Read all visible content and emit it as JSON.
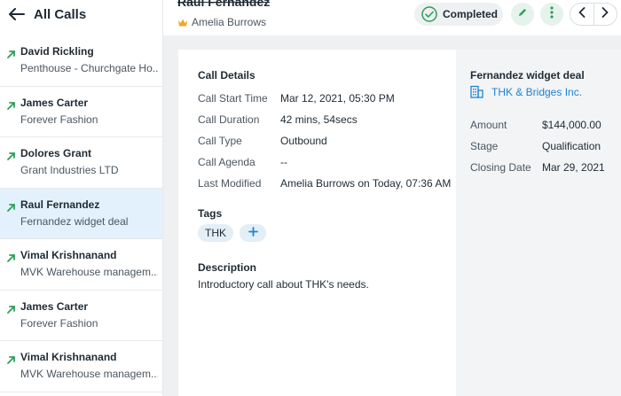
{
  "sidebar": {
    "title": "All Calls",
    "calls": [
      {
        "name": "David Rickling",
        "sub": "Penthouse - Churchgate Ho..."
      },
      {
        "name": "James Carter",
        "sub": "Forever Fashion"
      },
      {
        "name": "Dolores Grant",
        "sub": "Grant Industries LTD"
      },
      {
        "name": "Raul Fernandez",
        "sub": "Fernandez widget deal"
      },
      {
        "name": "Vimal Krishnanand",
        "sub": "MVK Warehouse managem..."
      },
      {
        "name": "James Carter",
        "sub": "Forever Fashion"
      },
      {
        "name": "Vimal Krishnanand",
        "sub": "MVK Warehouse managem..."
      }
    ]
  },
  "header": {
    "title": "Raul Fernandez",
    "owner": "Amelia Burrows",
    "status": "Completed"
  },
  "details": {
    "section_title": "Call Details",
    "rows": [
      {
        "label": "Call Start Time",
        "value": "Mar 12, 2021, 05:30 PM"
      },
      {
        "label": "Call Duration",
        "value": "42 mins, 54secs"
      },
      {
        "label": "Call Type",
        "value": "Outbound"
      },
      {
        "label": "Call Agenda",
        "value": "--"
      },
      {
        "label": "Last Modified",
        "value": "Amelia Burrows on Today, 07:36 AM"
      }
    ],
    "tags_title": "Tags",
    "tags": [
      "THK"
    ],
    "description_title": "Description",
    "description": "Introductory call about THK's needs."
  },
  "deal": {
    "title": "Fernandez widget deal",
    "company": "THK & Bridges Inc.",
    "rows": [
      {
        "label": "Amount",
        "value": "$144,000.00"
      },
      {
        "label": "Stage",
        "value": "Qualification"
      },
      {
        "label": "Closing Date",
        "value": "Mar 29, 2021"
      }
    ]
  },
  "colors": {
    "selected_row": "#e3f1fc",
    "accent_green": "#2e9e5b",
    "link_blue": "#1f84cd",
    "panel_bg": "#eef0f2"
  }
}
